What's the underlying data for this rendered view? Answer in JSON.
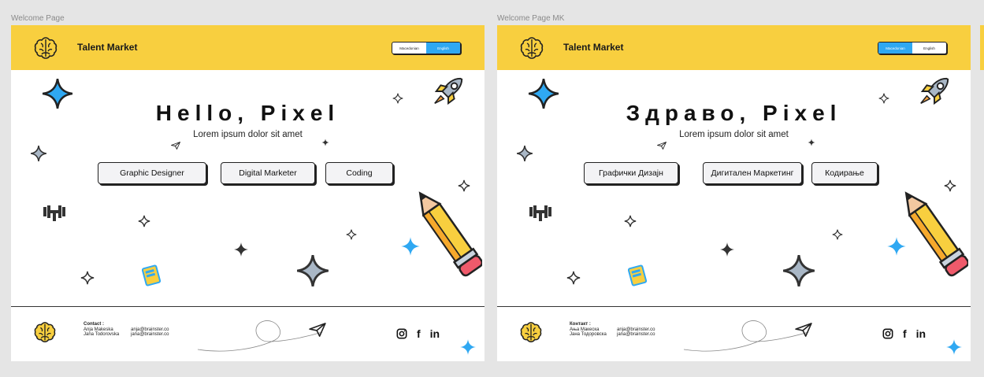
{
  "frames": [
    {
      "label": "Welcome Page",
      "brand": "Talent Market",
      "lang_options": [
        {
          "label": "Macedonian",
          "active": false
        },
        {
          "label": "English",
          "active": true
        }
      ],
      "title": "Hello, Pixel",
      "subtitle": "Lorem ipsum dolor sit amet",
      "buttons": [
        "Graphic Designer",
        "Digital Marketer",
        "Coding"
      ],
      "contact": {
        "title": "Contact :",
        "people": [
          {
            "name": "Anja Makeska",
            "email": "anja@brainster.co"
          },
          {
            "name": "Jana Todorovska",
            "email": "jana@brainster.co"
          }
        ]
      },
      "social": {
        "instagram": "instagram-icon",
        "facebook": "f",
        "linkedin": "in"
      }
    },
    {
      "label": "Welcome Page MK",
      "brand": "Talent Market",
      "lang_options": [
        {
          "label": "Macedonian",
          "active": true
        },
        {
          "label": "English",
          "active": false
        }
      ],
      "title": "Здраво, Pixel",
      "subtitle": "Lorem ipsum dolor sit amet",
      "buttons": [
        "Графички Дизајн",
        "Дигитален Маркетинг",
        "Кодирање"
      ],
      "contact": {
        "title": "Контакт :",
        "people": [
          {
            "name": "Ања Макеска",
            "email": "anja@brainster.co"
          },
          {
            "name": "Јана Тодоровска",
            "email": "jana@brainster.co"
          }
        ]
      },
      "social": {
        "instagram": "instagram-icon",
        "facebook": "f",
        "linkedin": "in"
      }
    }
  ],
  "colors": {
    "header": "#f8cf3f",
    "accent_blue": "#2fa8f2",
    "star_grey": "#a9b7c6"
  }
}
